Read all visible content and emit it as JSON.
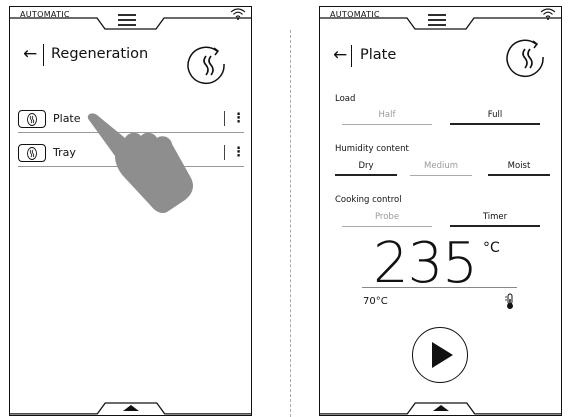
{
  "left_screen": {
    "mode": "AUTOMATIC",
    "title": "Regeneration",
    "items": [
      {
        "label": "Plate"
      },
      {
        "label": "Tray"
      }
    ]
  },
  "right_screen": {
    "mode": "AUTOMATIC",
    "title": "Plate",
    "load": {
      "label": "Load",
      "options": [
        "Half",
        "Full"
      ],
      "selected": "Full"
    },
    "humidity": {
      "label": "Humidity content",
      "options": [
        "Dry",
        "Medium",
        "Moist"
      ],
      "selected": [
        "Dry",
        "Moist"
      ]
    },
    "cooking_control": {
      "label": "Cooking control",
      "options": [
        "Probe",
        "Timer"
      ],
      "selected": "Timer"
    },
    "temperature": {
      "value": "235",
      "unit": "°C"
    },
    "probe_temperature": "70°C"
  }
}
